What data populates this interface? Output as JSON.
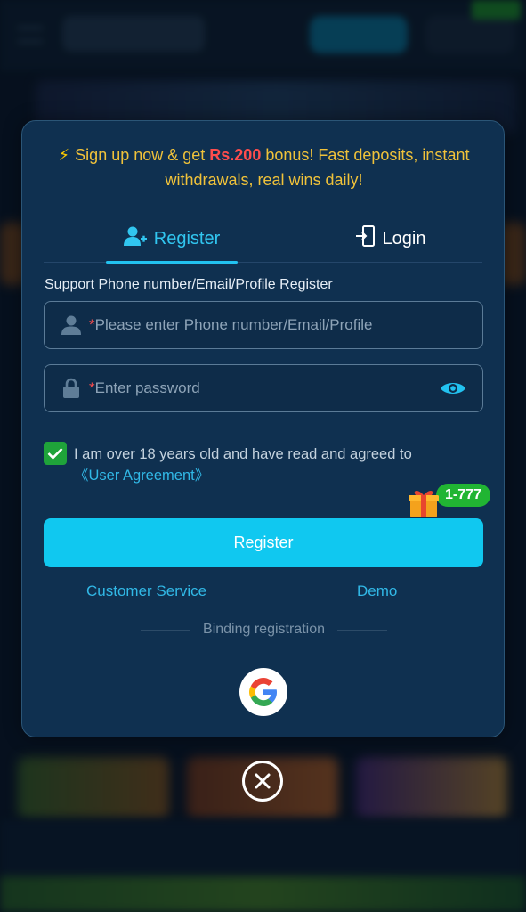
{
  "promo": {
    "bolt": "⚡",
    "text_before": "Sign up now & get ",
    "amount": "Rs.200",
    "text_after": " bonus! Fast deposits, instant withdrawals, real wins daily!"
  },
  "tabs": [
    {
      "label": "Register",
      "icon": "add-user-icon",
      "active": true
    },
    {
      "label": "Login",
      "icon": "login-door-icon",
      "active": false
    }
  ],
  "form": {
    "support_label": "Support Phone number/Email/Profile Register",
    "phone": {
      "required_mark": "*",
      "placeholder": "Please enter Phone number/Email/Profile",
      "value": ""
    },
    "password": {
      "required_mark": "*",
      "placeholder": "Enter password",
      "value": ""
    },
    "agreement": {
      "checked": true,
      "text": "I am over 18 years old and have read and agreed to",
      "link": "《User Agreement》"
    },
    "gift_badge": "1-777",
    "register_button": "Register"
  },
  "links": {
    "customer_service": "Customer Service",
    "demo": "Demo"
  },
  "binding_label": "Binding registration",
  "colors": {
    "accent": "#10c8f0",
    "promo_text": "#f0c23a",
    "promo_amount": "#ff4d4d",
    "checkbox": "#1fa33a",
    "badge": "#21b533"
  }
}
